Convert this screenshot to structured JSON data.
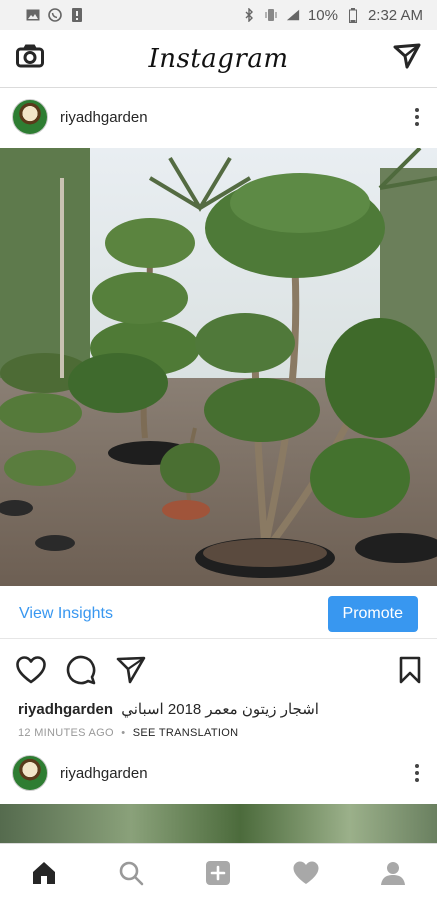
{
  "status_bar": {
    "battery": "10%",
    "time": "2:32 AM"
  },
  "app": {
    "title": "Instagram"
  },
  "post1": {
    "username": "riyadhgarden",
    "view_insights": "View Insights",
    "promote": "Promote",
    "caption_user": "riyadhgarden",
    "caption_text": "اشجار زيتون معمر 2018 اسباني",
    "time_ago": "12 MINUTES AGO",
    "separator": "•",
    "see_translation": "SEE TRANSLATION"
  },
  "post2": {
    "username": "riyadhgarden"
  },
  "icons": {
    "status": [
      "image-icon",
      "whatsapp-icon",
      "alert-icon",
      "bluetooth-icon",
      "vibrate-icon",
      "signal-icon",
      "battery-icon"
    ],
    "appbar": [
      "camera-icon",
      "direct-message-icon"
    ],
    "actions": [
      "like-heart-icon",
      "comment-icon",
      "share-icon",
      "bookmark-icon"
    ],
    "nav": [
      "home-icon",
      "search-icon",
      "add-post-icon",
      "activity-heart-icon",
      "profile-icon"
    ]
  },
  "colors": {
    "accent": "#3897f0",
    "text": "#262626",
    "muted": "#999999"
  }
}
